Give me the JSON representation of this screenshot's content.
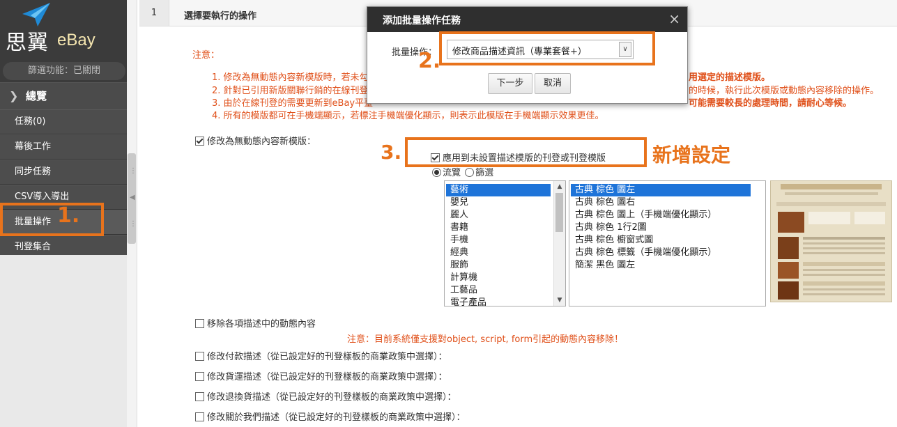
{
  "sidebar": {
    "logo_cn": "思翼",
    "logo_brand": "eBay",
    "filter_status": "篩選功能：已關閉",
    "overview_label": "總覽",
    "items": [
      {
        "label": "任務(0)"
      },
      {
        "label": "幕後工作"
      },
      {
        "label": "同步任務"
      },
      {
        "label": "CSV導入導出"
      },
      {
        "label": "批量操作"
      },
      {
        "label": "刊登集合"
      }
    ]
  },
  "main": {
    "step_number": "1",
    "step_title": "選擇要執行的操作",
    "note_head": "注意：",
    "notes": [
      "1. 修改為無動態內容新模版時，若未勾",
      "2. 針對已引用新版關聯行銷的在線刊登",
      "3. 由於在線刊登的需要更新到eBay平臺",
      "4. 所有的模版都可在手機端顯示，若標注手機端優化顯示，則表示此模版在手機端顯示效果更佳。"
    ],
    "notes_right": [
      "用選定的描述模版。",
      "的時候，執行此次模版或動態內容移除的操作。",
      "可能需要較長的處理時間，請耐心等候。"
    ],
    "option_new_template": "修改為無動態內容新模版：",
    "option_apply_unset": "應用到未設置描述模版的刊登或刊登模版",
    "radio_browse": "流覽",
    "radio_filter": "篩選",
    "categories": [
      "藝術",
      "嬰兒",
      "麗人",
      "書籍",
      "手機",
      "經典",
      "服飾",
      "計算機",
      "工藝品",
      "電子產品"
    ],
    "templates": [
      "古典 棕色 圖左",
      "古典 棕色 圖右",
      "古典 棕色 圖上（手機端優化顯示）",
      "古典 棕色 1行2圖",
      "古典 棕色 櫥窗式圖",
      "古典 棕色 標籤（手機端優化顯示）",
      "簡潔 黑色 圖左"
    ],
    "option_remove_dynamic": "移除各項描述中的動態內容",
    "warn": "注意：目前系統僅支援對object, script, form引起的動態內容移除！",
    "option_payment": "修改付款描述（從已設定好的刊登樣板的商業政策中選擇）：",
    "option_shipping": "修改貨運描述（從已設定好的刊登樣板的商業政策中選擇）：",
    "option_return": "修改退換貨描述（從已設定好的刊登樣板的商業政策中選擇）：",
    "option_about": "修改關於我們描述（從已設定好的刊登樣板的商業政策中選擇）："
  },
  "dialog": {
    "title": "添加批量操作任務",
    "close": "×",
    "label": "批量操作：",
    "selected": "修改商品描述資訊（專業套餐+）",
    "next_button": "下一步",
    "cancel_button": "取消"
  },
  "callouts": {
    "one": "1.",
    "two": "2.",
    "three": "3.",
    "new_setting": "新增設定"
  },
  "colors": {
    "accent_orange": "#e8731c",
    "note_red": "#e0501a",
    "sidebar_dark": "#3b3b3b",
    "selection_blue": "#1e74d9"
  }
}
